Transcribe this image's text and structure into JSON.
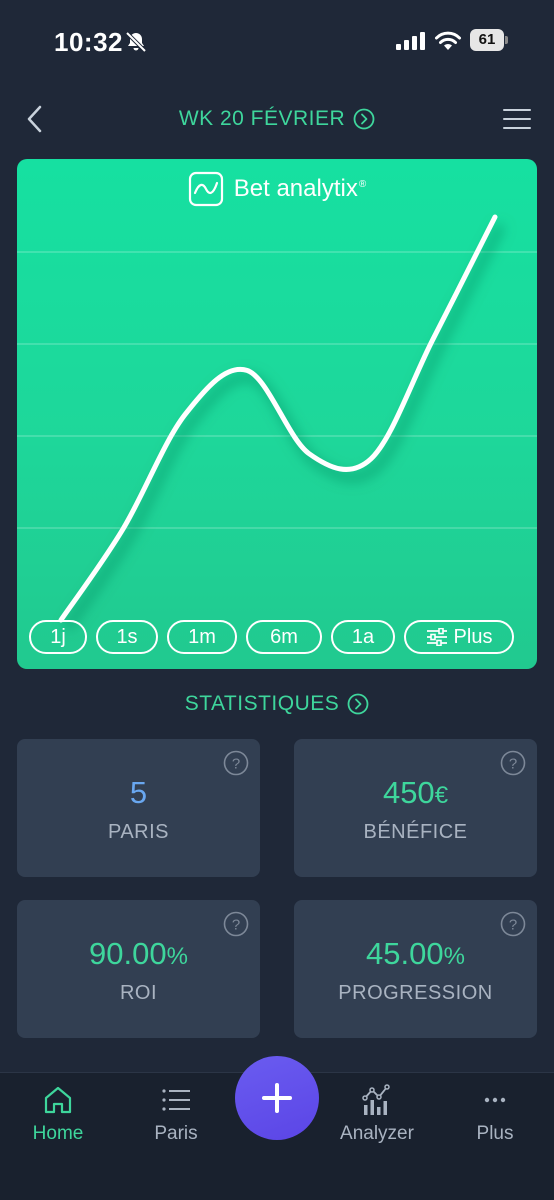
{
  "status_bar": {
    "time": "10:32",
    "battery": "61"
  },
  "header": {
    "title": "WK 20 FÉVRIER"
  },
  "chart": {
    "brand_name": "Bet analytix",
    "brand_reg": "®",
    "ranges": [
      "1j",
      "1s",
      "1m",
      "6m",
      "1a"
    ],
    "more_label": "Plus",
    "accent_color": "#1ed79a"
  },
  "chart_data": {
    "type": "line",
    "series": [
      {
        "values": [
          0,
          3.5,
          7.9,
          9.6,
          6.4,
          6.2,
          10.8,
          15.5
        ]
      }
    ],
    "x": [
      0,
      1,
      2,
      3,
      4,
      5,
      6,
      7
    ],
    "grid": true,
    "legend": "none"
  },
  "stats": {
    "title": "STATISTIQUES",
    "cards": [
      {
        "value": "5",
        "unit": "",
        "label": "PARIS"
      },
      {
        "value": "450",
        "unit": "€",
        "label": "BÉNÉFICE"
      },
      {
        "value": "90.00",
        "unit": "%",
        "label": "ROI"
      },
      {
        "value": "45.00",
        "unit": "%",
        "label": "PROGRESSION"
      }
    ]
  },
  "tab_bar": {
    "home": "Home",
    "paris": "Paris",
    "analyzer": "Analyzer",
    "plus": "Plus"
  },
  "colors": {
    "accent": "#3ed69c",
    "background": "#1f2838",
    "card": "#323f52",
    "fab": "#5b45e6",
    "value_blue": "#69a7f0"
  }
}
